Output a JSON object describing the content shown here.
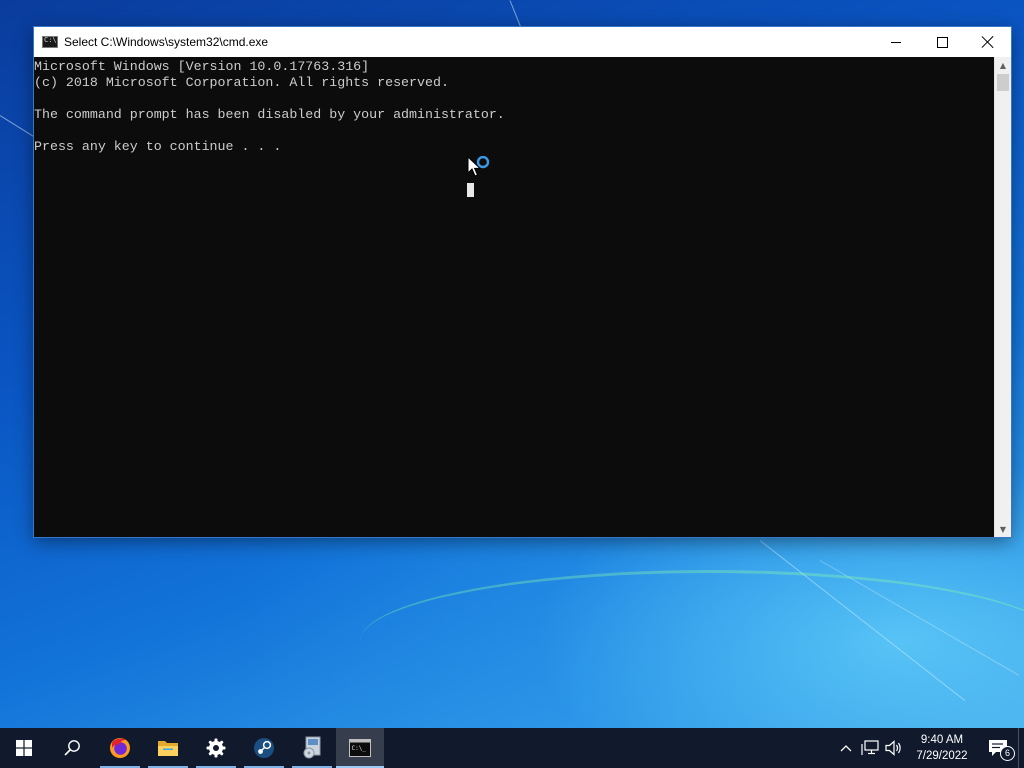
{
  "window": {
    "title": "Select C:\\Windows\\system32\\cmd.exe",
    "icon": "console-icon",
    "minimize_icon": "minimize-icon",
    "maximize_icon": "maximize-icon",
    "close_icon": "close-icon"
  },
  "console": {
    "lines": [
      "Microsoft Windows [Version 10.0.17763.316]",
      "(c) 2018 Microsoft Corporation. All rights reserved.",
      "",
      "The command prompt has been disabled by your administrator.",
      "",
      "Press any key to continue . . ."
    ],
    "background": "#0c0c0c",
    "foreground": "#cccccc"
  },
  "scrollbar": {
    "up_icon": "scroll-up-arrow-icon",
    "down_icon": "scroll-down-arrow-icon"
  },
  "taskbar": {
    "background": "#101a2c",
    "items": [
      {
        "name": "start",
        "icon": "windows-start-icon"
      },
      {
        "name": "search",
        "icon": "search-icon"
      },
      {
        "name": "firefox",
        "icon": "firefox-icon",
        "running": true
      },
      {
        "name": "file-explorer",
        "icon": "folder-icon",
        "running": true
      },
      {
        "name": "settings",
        "icon": "gear-icon",
        "running": true
      },
      {
        "name": "steam",
        "icon": "steam-icon",
        "running": true
      },
      {
        "name": "installer",
        "icon": "installer-icon",
        "running": true
      },
      {
        "name": "command-prompt",
        "icon": "console-icon",
        "running": true,
        "active": true
      }
    ],
    "tray": {
      "icons": [
        "chevron-up-icon",
        "network-icon",
        "volume-icon"
      ],
      "time": "9:40 AM",
      "date": "7/29/2022",
      "notification_count": "6",
      "notification_icon": "action-center-icon"
    }
  },
  "colors": {
    "desktop_accent": "#1273d8",
    "titlebar": "#ffffff",
    "busy_ring": "#3a9ae8"
  }
}
